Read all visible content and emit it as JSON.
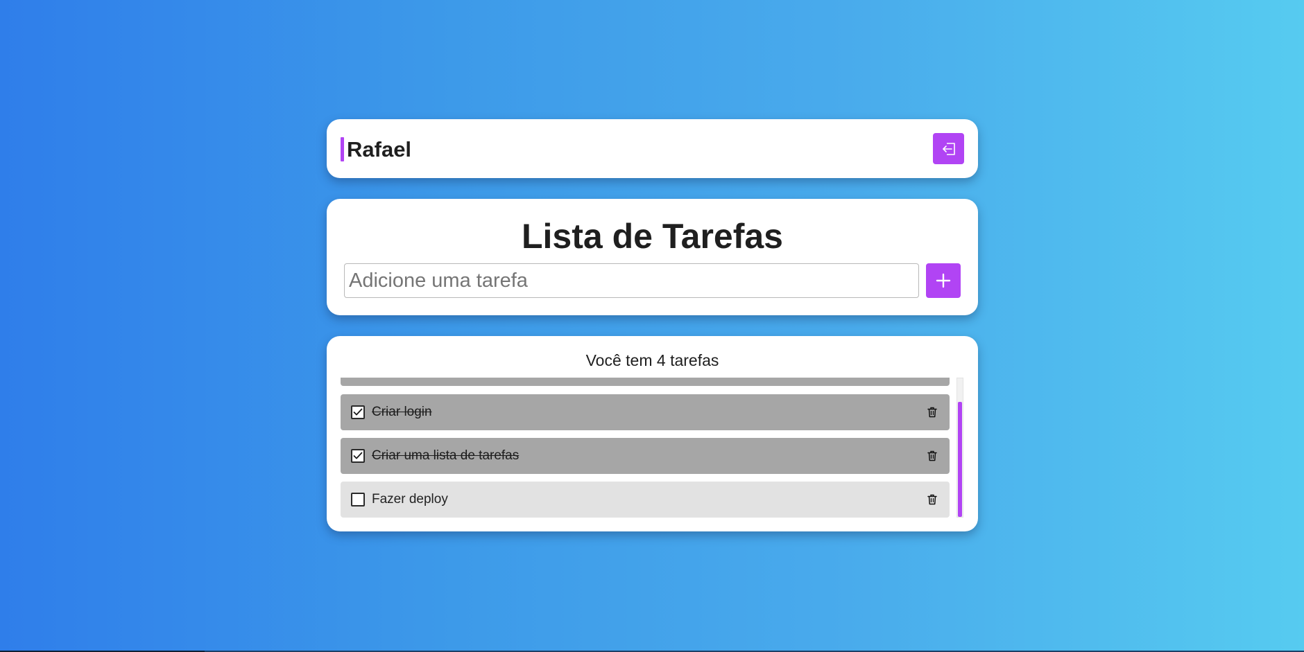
{
  "theme": {
    "accent": "#b144f4",
    "background_from": "#2f7eea",
    "background_to": "#56cbf0",
    "done_row": "#a6a6a6",
    "open_row": "#e2e2e2"
  },
  "header": {
    "user_name": "Rafael",
    "logout_icon": "logout-icon"
  },
  "add_task": {
    "title": "Lista de Tarefas",
    "input_value": "",
    "input_placeholder": "Adicione uma tarefa",
    "add_icon": "plus-icon"
  },
  "task_list": {
    "count_text": "Você tem 4 tarefas",
    "tasks": [
      {
        "label": "",
        "done": true
      },
      {
        "label": "Criar login",
        "done": true
      },
      {
        "label": "Criar uma lista de tarefas",
        "done": true
      },
      {
        "label": "Fazer deploy",
        "done": false
      }
    ],
    "delete_icon": "trash-icon",
    "check_icon": "checkmark-icon"
  }
}
